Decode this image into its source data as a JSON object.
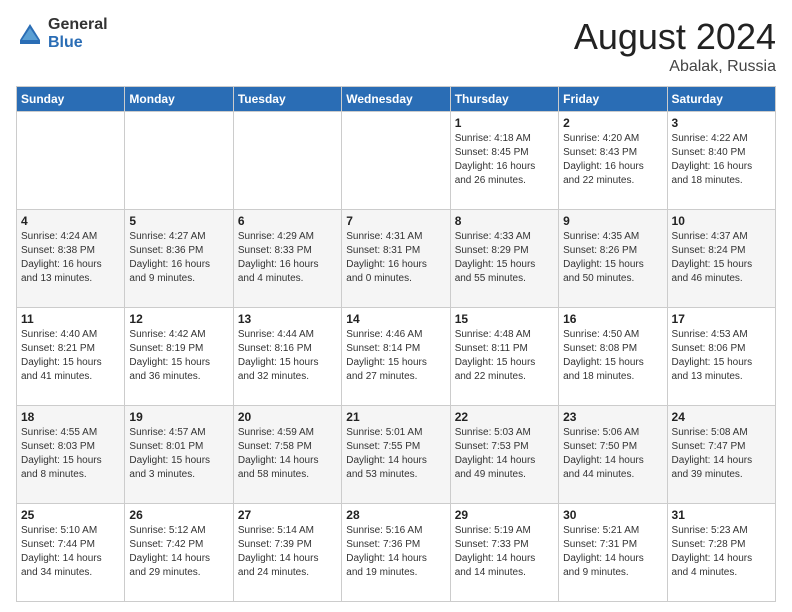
{
  "logo": {
    "general": "General",
    "blue": "Blue"
  },
  "header": {
    "month": "August 2024",
    "location": "Abalak, Russia"
  },
  "weekdays": [
    "Sunday",
    "Monday",
    "Tuesday",
    "Wednesday",
    "Thursday",
    "Friday",
    "Saturday"
  ],
  "weeks": [
    [
      {
        "day": "",
        "info": ""
      },
      {
        "day": "",
        "info": ""
      },
      {
        "day": "",
        "info": ""
      },
      {
        "day": "",
        "info": ""
      },
      {
        "day": "1",
        "info": "Sunrise: 4:18 AM\nSunset: 8:45 PM\nDaylight: 16 hours\nand 26 minutes."
      },
      {
        "day": "2",
        "info": "Sunrise: 4:20 AM\nSunset: 8:43 PM\nDaylight: 16 hours\nand 22 minutes."
      },
      {
        "day": "3",
        "info": "Sunrise: 4:22 AM\nSunset: 8:40 PM\nDaylight: 16 hours\nand 18 minutes."
      }
    ],
    [
      {
        "day": "4",
        "info": "Sunrise: 4:24 AM\nSunset: 8:38 PM\nDaylight: 16 hours\nand 13 minutes."
      },
      {
        "day": "5",
        "info": "Sunrise: 4:27 AM\nSunset: 8:36 PM\nDaylight: 16 hours\nand 9 minutes."
      },
      {
        "day": "6",
        "info": "Sunrise: 4:29 AM\nSunset: 8:33 PM\nDaylight: 16 hours\nand 4 minutes."
      },
      {
        "day": "7",
        "info": "Sunrise: 4:31 AM\nSunset: 8:31 PM\nDaylight: 16 hours\nand 0 minutes."
      },
      {
        "day": "8",
        "info": "Sunrise: 4:33 AM\nSunset: 8:29 PM\nDaylight: 15 hours\nand 55 minutes."
      },
      {
        "day": "9",
        "info": "Sunrise: 4:35 AM\nSunset: 8:26 PM\nDaylight: 15 hours\nand 50 minutes."
      },
      {
        "day": "10",
        "info": "Sunrise: 4:37 AM\nSunset: 8:24 PM\nDaylight: 15 hours\nand 46 minutes."
      }
    ],
    [
      {
        "day": "11",
        "info": "Sunrise: 4:40 AM\nSunset: 8:21 PM\nDaylight: 15 hours\nand 41 minutes."
      },
      {
        "day": "12",
        "info": "Sunrise: 4:42 AM\nSunset: 8:19 PM\nDaylight: 15 hours\nand 36 minutes."
      },
      {
        "day": "13",
        "info": "Sunrise: 4:44 AM\nSunset: 8:16 PM\nDaylight: 15 hours\nand 32 minutes."
      },
      {
        "day": "14",
        "info": "Sunrise: 4:46 AM\nSunset: 8:14 PM\nDaylight: 15 hours\nand 27 minutes."
      },
      {
        "day": "15",
        "info": "Sunrise: 4:48 AM\nSunset: 8:11 PM\nDaylight: 15 hours\nand 22 minutes."
      },
      {
        "day": "16",
        "info": "Sunrise: 4:50 AM\nSunset: 8:08 PM\nDaylight: 15 hours\nand 18 minutes."
      },
      {
        "day": "17",
        "info": "Sunrise: 4:53 AM\nSunset: 8:06 PM\nDaylight: 15 hours\nand 13 minutes."
      }
    ],
    [
      {
        "day": "18",
        "info": "Sunrise: 4:55 AM\nSunset: 8:03 PM\nDaylight: 15 hours\nand 8 minutes."
      },
      {
        "day": "19",
        "info": "Sunrise: 4:57 AM\nSunset: 8:01 PM\nDaylight: 15 hours\nand 3 minutes."
      },
      {
        "day": "20",
        "info": "Sunrise: 4:59 AM\nSunset: 7:58 PM\nDaylight: 14 hours\nand 58 minutes."
      },
      {
        "day": "21",
        "info": "Sunrise: 5:01 AM\nSunset: 7:55 PM\nDaylight: 14 hours\nand 53 minutes."
      },
      {
        "day": "22",
        "info": "Sunrise: 5:03 AM\nSunset: 7:53 PM\nDaylight: 14 hours\nand 49 minutes."
      },
      {
        "day": "23",
        "info": "Sunrise: 5:06 AM\nSunset: 7:50 PM\nDaylight: 14 hours\nand 44 minutes."
      },
      {
        "day": "24",
        "info": "Sunrise: 5:08 AM\nSunset: 7:47 PM\nDaylight: 14 hours\nand 39 minutes."
      }
    ],
    [
      {
        "day": "25",
        "info": "Sunrise: 5:10 AM\nSunset: 7:44 PM\nDaylight: 14 hours\nand 34 minutes."
      },
      {
        "day": "26",
        "info": "Sunrise: 5:12 AM\nSunset: 7:42 PM\nDaylight: 14 hours\nand 29 minutes."
      },
      {
        "day": "27",
        "info": "Sunrise: 5:14 AM\nSunset: 7:39 PM\nDaylight: 14 hours\nand 24 minutes."
      },
      {
        "day": "28",
        "info": "Sunrise: 5:16 AM\nSunset: 7:36 PM\nDaylight: 14 hours\nand 19 minutes."
      },
      {
        "day": "29",
        "info": "Sunrise: 5:19 AM\nSunset: 7:33 PM\nDaylight: 14 hours\nand 14 minutes."
      },
      {
        "day": "30",
        "info": "Sunrise: 5:21 AM\nSunset: 7:31 PM\nDaylight: 14 hours\nand 9 minutes."
      },
      {
        "day": "31",
        "info": "Sunrise: 5:23 AM\nSunset: 7:28 PM\nDaylight: 14 hours\nand 4 minutes."
      }
    ]
  ]
}
